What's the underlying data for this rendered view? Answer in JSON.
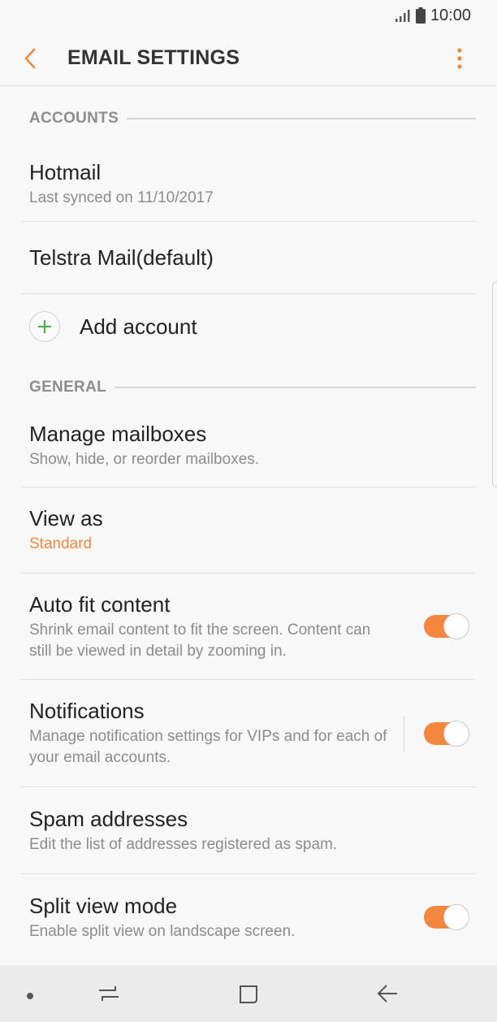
{
  "status_bar": {
    "time": "10:00"
  },
  "app_bar": {
    "title": "EMAIL SETTINGS"
  },
  "sections": {
    "accounts": {
      "header": "ACCOUNTS",
      "hotmail": {
        "title": "Hotmail",
        "subtitle": "Last synced on 11/10/2017"
      },
      "telstra": {
        "title": "Telstra Mail(default)"
      },
      "add_account": {
        "label": "Add account"
      }
    },
    "general": {
      "header": "GENERAL",
      "manage_mailboxes": {
        "title": "Manage mailboxes",
        "subtitle": "Show, hide, or reorder mailboxes."
      },
      "view_as": {
        "title": "View as",
        "value": "Standard"
      },
      "auto_fit": {
        "title": "Auto fit content",
        "subtitle": "Shrink email content to fit the screen. Content can still be viewed in detail by zooming in.",
        "enabled": true
      },
      "notifications": {
        "title": "Notifications",
        "subtitle": "Manage notification settings for VIPs and for each of your email accounts.",
        "enabled": true
      },
      "spam": {
        "title": "Spam addresses",
        "subtitle": "Edit the list of addresses registered as spam."
      },
      "split_view": {
        "title": "Split view mode",
        "subtitle": "Enable split view on landscape screen.",
        "enabled": true
      }
    }
  },
  "colors": {
    "accent": "#f2883e",
    "toggle_on": "#f4873d",
    "add_plus": "#3bb53b"
  },
  "icons": {
    "back": "chevron-left-icon",
    "more": "more-vertical-icon",
    "add": "plus-icon",
    "nav_dot": "dot-icon",
    "nav_recents": "recents-icon",
    "nav_home": "home-icon",
    "nav_back": "back-arrow-icon"
  }
}
